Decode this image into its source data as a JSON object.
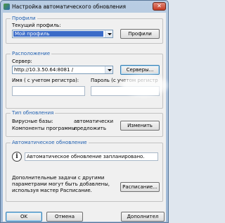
{
  "window": {
    "title": "Настройка автоматического обновления",
    "close_glyph": "✕"
  },
  "profiles": {
    "legend": "Профили",
    "current_label": "Текущий профиль:",
    "current_value": "Мой профиль",
    "button": "Профили"
  },
  "location": {
    "legend": "Расположение",
    "server_label": "Сервер:",
    "server_value": "http://10.3.50.64:8081 /",
    "servers_button": "Серверы...",
    "name_label": "Имя ( с учетом регистра):",
    "password_label": "Пароль (с учетом регистр",
    "name_value": "",
    "password_value": ""
  },
  "update_type": {
    "legend": "Тип обновления",
    "virus_label": "Вирусные базы:",
    "virus_value": "автоматически",
    "components_label": "Компоненты программы:",
    "components_value": "предложить",
    "change_button": "Изменить"
  },
  "auto_update": {
    "legend": "Автоматическое обновление",
    "status": "Автоматическое обновление запланировано.",
    "description_line1": "Дополнительные задачи с другими",
    "description_line2": "параметрами могут быть добавлены,",
    "description_line3": "используя мастер Расписание.",
    "schedule_button": "Расписание..."
  },
  "footer": {
    "ok": "OK",
    "cancel": "Отмена",
    "advanced": "Дополнител"
  }
}
